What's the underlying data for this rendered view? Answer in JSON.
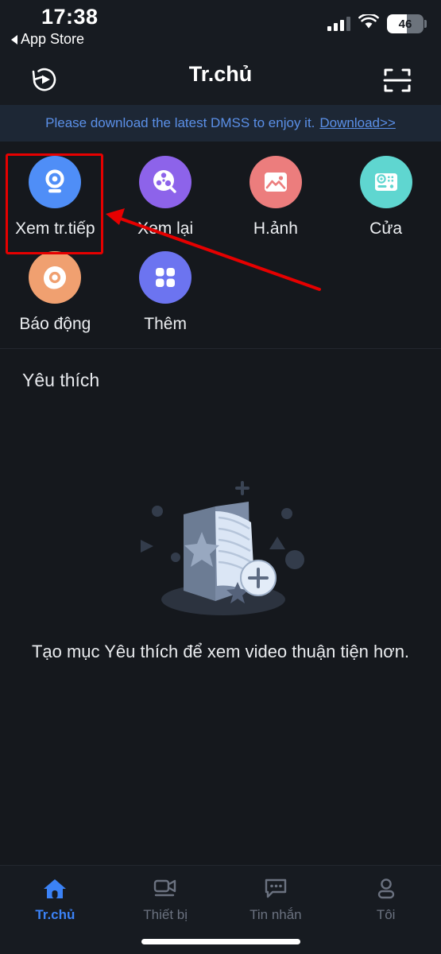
{
  "status_bar": {
    "time": "17:38",
    "back_label": "App Store",
    "battery_level": "46",
    "signal_icon": "cellular-signal-icon",
    "wifi_icon": "wifi-icon",
    "battery_icon": "battery-icon"
  },
  "header": {
    "title": "Tr.chủ",
    "left_icon": "replay-history-icon",
    "right_icon": "qr-scan-icon"
  },
  "banner": {
    "text": "Please download the latest DMSS to enjoy it.",
    "link_label": "Download>>",
    "color": "#5b90e8",
    "background": "#1d2735"
  },
  "grid": {
    "items": [
      {
        "label": "Xem tr.tiếp",
        "icon": "camera-live-icon",
        "color": "#4f8ef7",
        "highlighted": true
      },
      {
        "label": "Xem lại",
        "icon": "film-reel-icon",
        "color": "#8d63ea"
      },
      {
        "label": "H.ảnh",
        "icon": "photo-image-icon",
        "color": "#ec7d7d"
      },
      {
        "label": "Cửa",
        "icon": "door-station-icon",
        "color": "#5fd6d0"
      },
      {
        "label": "Báo động",
        "icon": "alarm-siren-icon",
        "color": "#f0a070"
      },
      {
        "label": "Thêm",
        "icon": "grid-more-icon",
        "color": "#6c74f0"
      }
    ]
  },
  "favorites": {
    "section_title": "Yêu thích",
    "empty_illustration": "empty-favorites-book-icon",
    "empty_text": "Tạo mục Yêu thích để xem video thuận tiện hơn."
  },
  "tabbar": {
    "items": [
      {
        "label": "Tr.chủ",
        "icon": "home-icon",
        "active": true
      },
      {
        "label": "Thiết bị",
        "icon": "device-camera-icon",
        "active": false
      },
      {
        "label": "Tin nhắn",
        "icon": "message-bubble-icon",
        "active": false
      },
      {
        "label": "Tôi",
        "icon": "person-profile-icon",
        "active": false
      }
    ],
    "active_color": "#3b82f6",
    "inactive_color": "#6b7280"
  },
  "annotations": {
    "highlight_box_color": "#e60000",
    "arrow_color": "#e60000",
    "arrow_target": "Xem tr.tiếp"
  }
}
